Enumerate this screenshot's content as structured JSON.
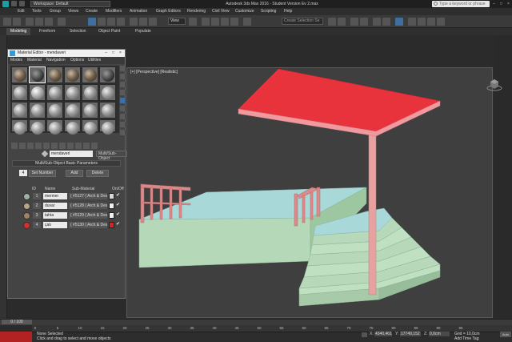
{
  "titlebar": {
    "workspace": "Workspace: Default",
    "title": "Autodesk 3ds Max 2016 - Student Version    Ev 2.max",
    "search_placeholder": "Type a keyword or phrase"
  },
  "menu": [
    "Edit",
    "Tools",
    "Group",
    "Views",
    "Create",
    "Modifiers",
    "Animation",
    "Graph Editors",
    "Rendering",
    "Civil View",
    "Customize",
    "Scripting",
    "Help"
  ],
  "toolbar": {
    "view": "View",
    "selection_set": "Create Selection Se"
  },
  "ribbon_tabs": [
    "Modeling",
    "Freeform",
    "Selection",
    "Object Paint",
    "Populate"
  ],
  "material_editor": {
    "title": "Material Editor - mendaveri",
    "menus": [
      "Modes",
      "Material",
      "Navigation",
      "Options",
      "Utilities"
    ],
    "material_name": "mendaveri",
    "material_type": "Multi/Sub-Object",
    "rollout_title": "Multi/Sub-Object Basic Parameters",
    "set_number_value": "4",
    "set_number_label": "Set Number",
    "add_label": "Add",
    "delete_label": "Delete",
    "headers": {
      "id": "ID",
      "name": "Name",
      "sub": "Sub-Material",
      "onoff": "On/Off"
    },
    "rows": [
      {
        "id": "1",
        "name": "mermer",
        "sub": "( #5127 ( Arch & Design ) )",
        "color": "#d8d8d8",
        "swatch": "#9fb0a8"
      },
      {
        "id": "2",
        "name": "duvar",
        "sub": "( #5128 ( Arch & Design ) )",
        "color": "#f2f2f2",
        "swatch": "#b8a58c"
      },
      {
        "id": "3",
        "name": "tahta",
        "sub": "( #5129 ( Arch & Design ) )",
        "color": "#f2f2f2",
        "swatch": "#a08466"
      },
      {
        "id": "4",
        "name": "çatı",
        "sub": "( #5130 ( Arch & Design ) )",
        "color": "#e02020",
        "swatch": "#d03030"
      }
    ]
  },
  "viewport": {
    "label": "[+] [Perspective] [Realistic]"
  },
  "timeline": {
    "frame_counter": "0 / 100",
    "ticks": [
      "0",
      "5",
      "10",
      "15",
      "20",
      "25",
      "30",
      "35",
      "40",
      "45",
      "50",
      "55",
      "60",
      "65",
      "70",
      "75",
      "80",
      "85",
      "90",
      "95"
    ]
  },
  "status": {
    "selected": "None Selected",
    "prompt": "Click and drag to select and move objects",
    "x_label": "X:",
    "x_value": "4340,461",
    "y_label": "Y:",
    "y_value": "17749,152",
    "z_label": "Z:",
    "z_value": "0,0cm",
    "grid": "Grid = 10,0cm",
    "time_tag": "Add Time Tag",
    "auto": "Auto"
  },
  "colors": {
    "roof": "#e8323c",
    "roof_edge": "#f09aa0",
    "pillar": "#e8a0a0",
    "railing": "#d98a8a",
    "floor_top": "#a8d8d8",
    "wall": "#b5d8b8",
    "steps": "#c0e0c2"
  }
}
